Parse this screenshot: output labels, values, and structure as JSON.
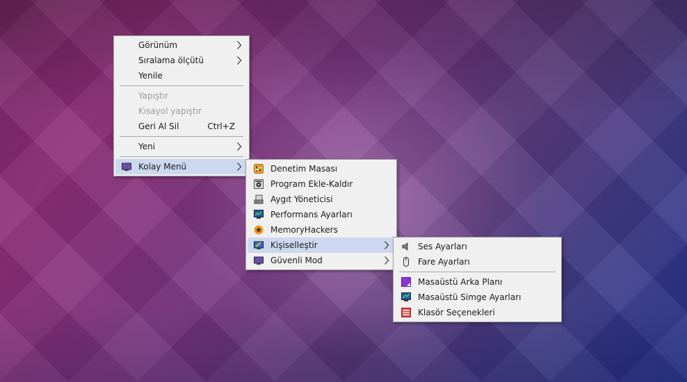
{
  "main_menu": {
    "items": [
      {
        "label": "Görünüm",
        "submenu": true
      },
      {
        "label": "Sıralama ölçütü",
        "submenu": true
      },
      {
        "label": "Yenile"
      },
      {
        "label": "Yapıştır",
        "disabled": true
      },
      {
        "label": "Kısayol yapıştır",
        "disabled": true
      },
      {
        "label": "Geri Al Sil",
        "shortcut": "Ctrl+Z"
      },
      {
        "label": "Yeni",
        "submenu": true
      },
      {
        "label": "Kolay Menü",
        "submenu": true,
        "highlighted": true,
        "icon": "monitor-icon"
      }
    ]
  },
  "kolay_menu": {
    "items": [
      {
        "label": "Denetim Masası",
        "icon": "control-panel-icon"
      },
      {
        "label": "Program Ekle-Kaldır",
        "icon": "programs-icon"
      },
      {
        "label": "Aygıt Yöneticisi",
        "icon": "device-manager-icon"
      },
      {
        "label": "Performans Ayarları",
        "icon": "performance-icon"
      },
      {
        "label": "MemoryHackers",
        "icon": "star-badge-icon"
      },
      {
        "label": "Kişiselleştir",
        "icon": "personalize-icon",
        "submenu": true,
        "highlighted": true
      },
      {
        "label": "Güvenli Mod",
        "icon": "monitor-icon",
        "submenu": true
      }
    ]
  },
  "kisisellestir_menu": {
    "items": [
      {
        "label": "Ses Ayarları",
        "icon": "speaker-icon"
      },
      {
        "label": "Fare Ayarları",
        "icon": "mouse-icon"
      },
      {
        "label": "Masaüstü Arka Planı",
        "icon": "wallpaper-icon"
      },
      {
        "label": "Masaüstü Simge Ayarları",
        "icon": "desktop-icons-icon"
      },
      {
        "label": "Klasör Seçenekleri",
        "icon": "folder-options-icon"
      }
    ]
  },
  "colors": {
    "highlight": "#ccd8ef",
    "menu_bg": "#f0f0f0",
    "disabled_text": "#9c9c9c"
  }
}
